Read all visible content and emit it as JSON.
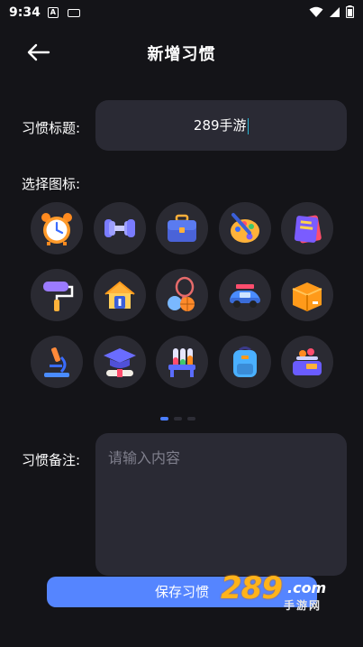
{
  "status_bar": {
    "time": "9:34",
    "notification_icon": "A",
    "icons": [
      "keyboard-icon",
      "wifi-icon",
      "signal-icon",
      "battery-icon"
    ]
  },
  "header": {
    "title": "新增习惯",
    "back_icon": "arrow-left-icon"
  },
  "form": {
    "title_label": "习惯标题:",
    "title_value": "289手游",
    "icon_label": "选择图标:",
    "note_label": "习惯备注:",
    "note_placeholder": "请输入内容",
    "save_label": "保存习惯"
  },
  "icons": [
    "alarm-clock-icon",
    "dumbbell-icon",
    "briefcase-icon",
    "paint-palette-icon",
    "notebook-icon",
    "paint-roller-icon",
    "house-icon",
    "sports-balls-icon",
    "car-icon",
    "package-box-icon",
    "microscope-icon",
    "graduation-cap-icon",
    "test-tubes-icon",
    "backpack-icon",
    "weighing-scale-icon"
  ],
  "pagination": {
    "pages": 3,
    "current": 1
  },
  "watermark": {
    "number": "289",
    "domain": ".com",
    "text": "手游网"
  },
  "colors": {
    "background": "#141418",
    "field": "#2a2a34",
    "accent": "#5585ff",
    "watermark": "#ffb31a"
  }
}
